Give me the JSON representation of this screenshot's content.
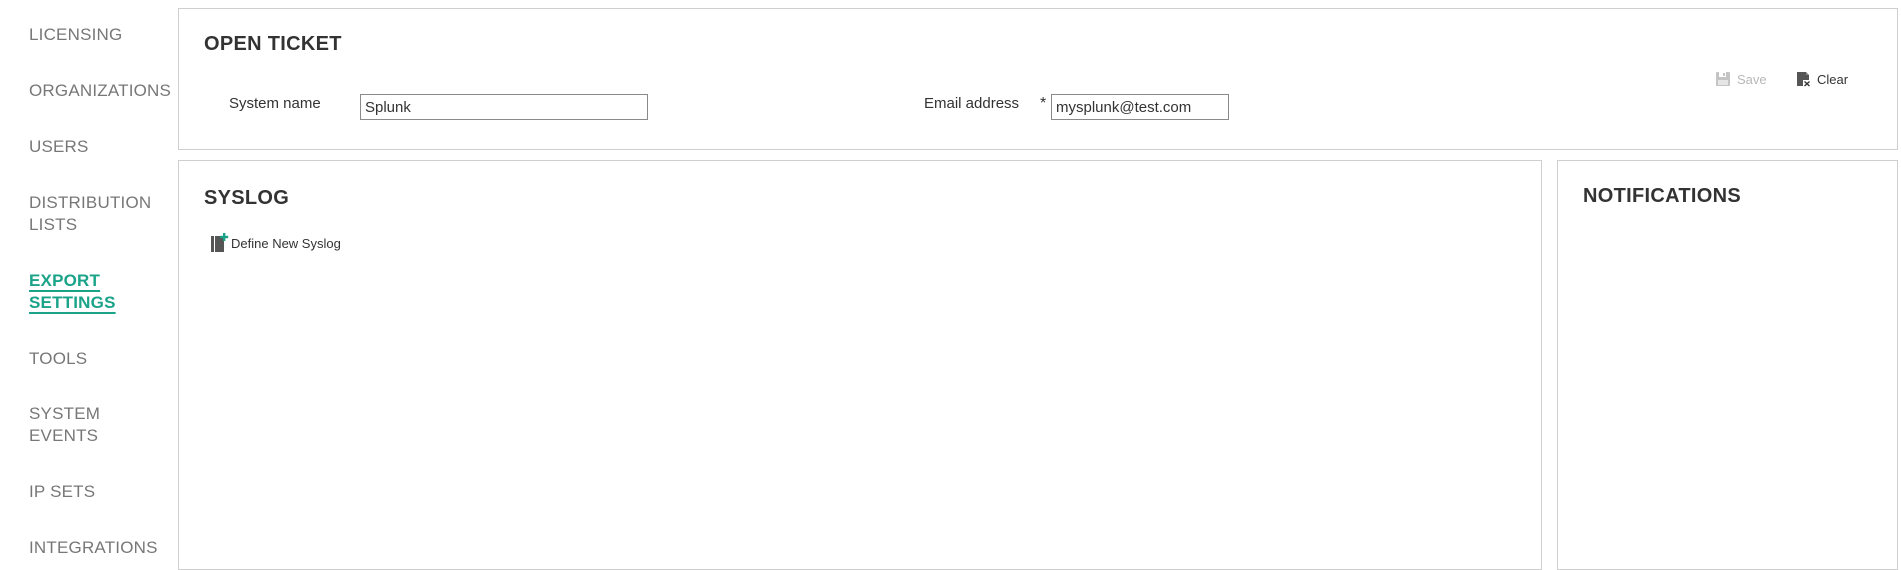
{
  "sidebar": {
    "items": [
      {
        "label": "LICENSING"
      },
      {
        "label": "ORGANIZATIONS"
      },
      {
        "label": "USERS"
      },
      {
        "label": "DISTRIBUTION",
        "label2": "LISTS"
      },
      {
        "label": "EXPORT",
        "label2": "SETTINGS",
        "active": true
      },
      {
        "label": "TOOLS"
      },
      {
        "label": "SYSTEM",
        "label2": "EVENTS"
      },
      {
        "label": "IP SETS"
      },
      {
        "label": "INTEGRATIONS"
      }
    ]
  },
  "open_ticket": {
    "title": "OPEN TICKET",
    "system_name_label": "System name",
    "system_name_value": "Splunk",
    "email_label": "Email address",
    "required_marker": "*",
    "email_value": "mysplunk@test.com",
    "save_label": "Save",
    "clear_label": "Clear"
  },
  "syslog": {
    "title": "SYSLOG",
    "define_new_label": "Define New Syslog"
  },
  "notifications": {
    "title": "NOTIFICATIONS"
  },
  "colors": {
    "accent": "#1aa389",
    "nav_text": "#777777",
    "border": "#cfcfcf",
    "disabled": "#b8b8b8"
  },
  "icons": {
    "save": "save-icon",
    "clear": "clear-icon",
    "define_new": "add-document-icon"
  }
}
